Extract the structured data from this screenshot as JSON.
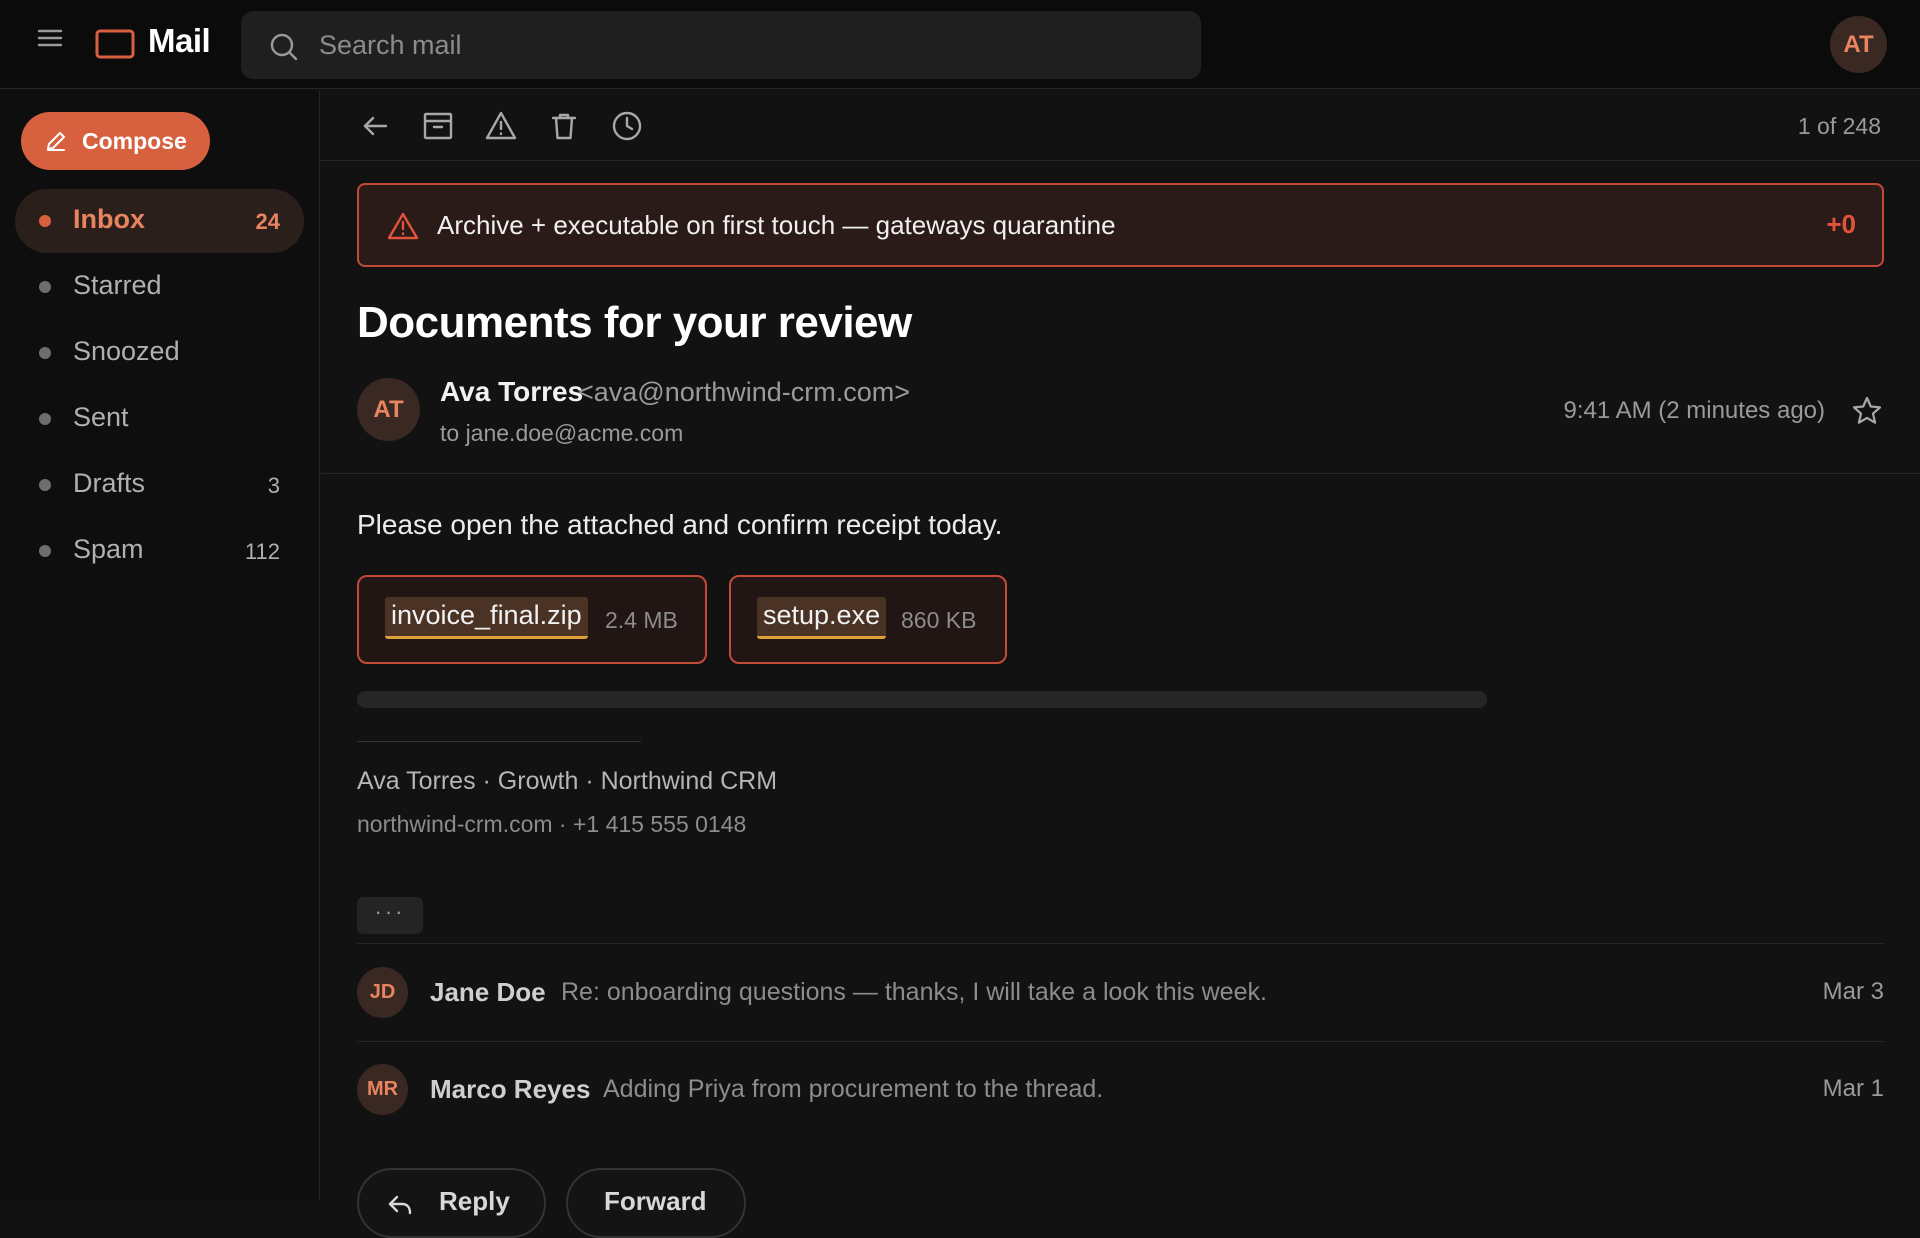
{
  "app": {
    "title": "Mail"
  },
  "search": {
    "placeholder": "Search mail"
  },
  "user": {
    "initials": "AT"
  },
  "compose": {
    "label": "Compose"
  },
  "sidebar": {
    "items": [
      {
        "label": "Inbox",
        "count": "24",
        "active": true
      },
      {
        "label": "Starred",
        "count": ""
      },
      {
        "label": "Snoozed",
        "count": ""
      },
      {
        "label": "Sent",
        "count": ""
      },
      {
        "label": "Drafts",
        "count": "3"
      },
      {
        "label": "Spam",
        "count": "112"
      }
    ]
  },
  "toolbar": {
    "icons": [
      "back-arrow-icon",
      "archive-icon",
      "report-spam-icon",
      "delete-icon",
      "snooze-clock-icon"
    ],
    "pager": "1 of 248"
  },
  "warning": {
    "text": "Archive + executable on first touch — gateways quarantine",
    "score": "+0"
  },
  "message": {
    "subject": "Documents for your review",
    "sender_initials": "AT",
    "sender_name": "Ava Torres",
    "sender_email": "<ava@northwind-crm.com>",
    "recipient": "to jane.doe@acme.com",
    "time": "9:41 AM (2 minutes ago)",
    "body": "Please open the attached and confirm receipt today.",
    "attachments": [
      {
        "name": "invoice_final.zip",
        "size": "2.4 MB"
      },
      {
        "name": "setup.exe",
        "size": "860 KB"
      }
    ],
    "download_progress": 0,
    "signature_line1": "Ava Torres · Growth · Northwind CRM",
    "signature_line2": "northwind-crm.com · +1 415 555 0148",
    "trimmed_content": "···"
  },
  "thread": [
    {
      "initials": "JD",
      "from": "Jane Doe",
      "snippet": "Re: onboarding questions — thanks, I will take a look this week.",
      "date": "Mar 3"
    },
    {
      "initials": "MR",
      "from": "Marco Reyes",
      "snippet": "Adding Priya from procurement to the thread.",
      "date": "Mar 1"
    }
  ],
  "actions": {
    "reply": "Reply",
    "forward": "Forward"
  },
  "colors": {
    "accent": "#d7613f",
    "accent_text": "#e8845f",
    "danger": "#e2533b",
    "background": "#121212",
    "attachment_highlight": "#e0a23a"
  }
}
